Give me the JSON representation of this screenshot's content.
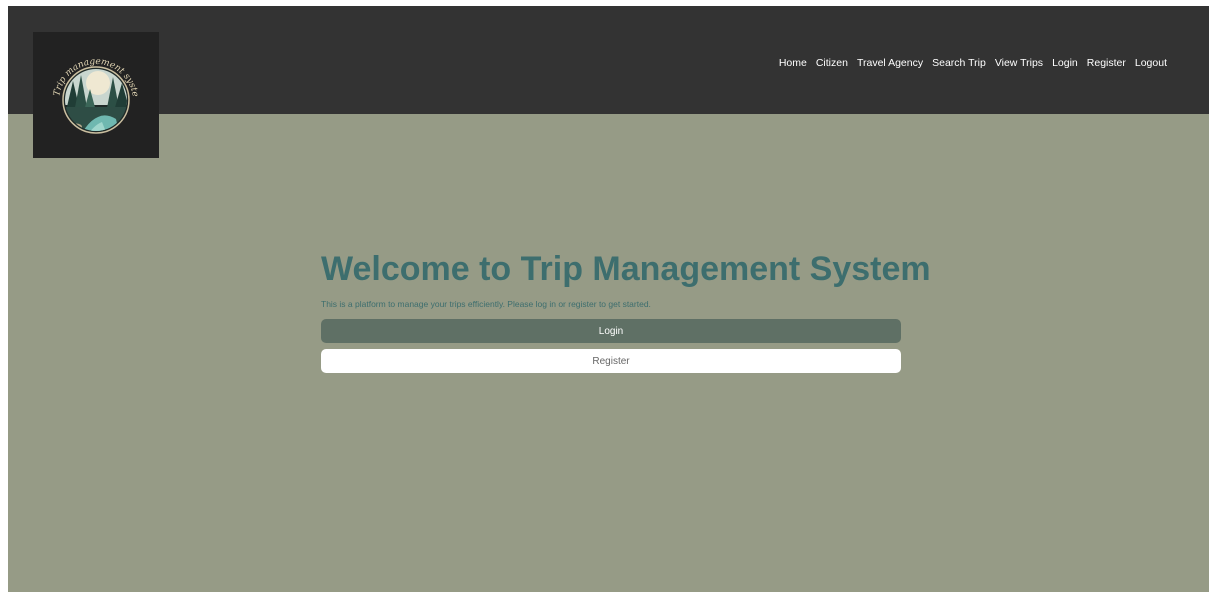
{
  "nav": {
    "logo_text": "Trip management system",
    "items": [
      {
        "label": "Home"
      },
      {
        "label": "Citizen"
      },
      {
        "label": "Travel Agency"
      },
      {
        "label": "Search Trip"
      },
      {
        "label": "View Trips"
      },
      {
        "label": "Login"
      },
      {
        "label": "Register"
      },
      {
        "label": "Logout"
      }
    ]
  },
  "main": {
    "title": "Welcome to Trip Management System",
    "subtitle": "This is a platform to manage your trips efficiently. Please log in or register to get started.",
    "login_label": "Login",
    "register_label": "Register"
  },
  "colors": {
    "navbar": "#333333",
    "background": "#969b86",
    "title": "#3d6e6e",
    "login_button": "#5f7065",
    "register_button": "#ffffff"
  }
}
